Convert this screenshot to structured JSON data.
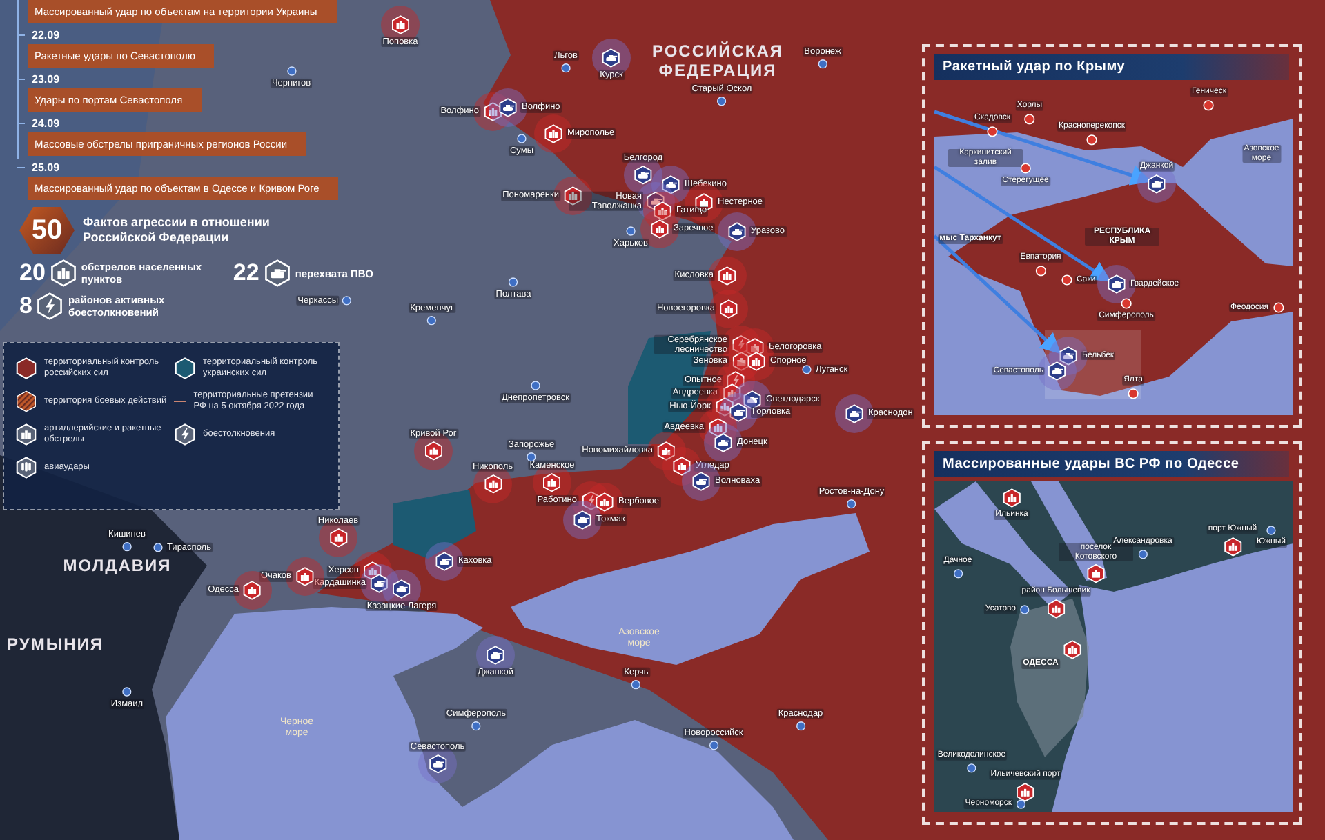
{
  "timeline": [
    {
      "text": "Массированный удар по объектам на территории Украины"
    },
    {
      "date": "22.09",
      "text": "Ракетные удары по Севастополю"
    },
    {
      "date": "23.09",
      "text": "Удары по портам Севастополя"
    },
    {
      "date": "24.09",
      "text": "Массовые обстрелы приграничных регионов России"
    },
    {
      "date": "25.09",
      "text": "Массированный удар по объектам в Одессе и Кривом Роге"
    }
  ],
  "summary": {
    "count": "50",
    "text": "Фактов агрессии в отношении Российской Федерации"
  },
  "stats": [
    {
      "count": "20",
      "text": "обстрелов населенных пунктов",
      "kind": "shelling"
    },
    {
      "count": "22",
      "text": "перехвата ПВО",
      "kind": "intercept"
    },
    {
      "count": "8",
      "text": "районов активных боестолкновений",
      "kind": "clash"
    }
  ],
  "legend": [
    {
      "kind": "ru-control",
      "text": "территориальный контроль российских сил"
    },
    {
      "kind": "ua-control",
      "text": "территориальный контроль украинских сил"
    },
    {
      "kind": "combat-zone",
      "text": "территория боевых действий"
    },
    {
      "kind": "claims-line",
      "text": "территориальные претензии РФ на 5 октября 2022 года"
    },
    {
      "kind": "shelling",
      "text": "артиллерийские и ракетные обстрелы"
    },
    {
      "kind": "clash",
      "text": "боестолкновения"
    },
    {
      "kind": "airstrike",
      "text": "авиаудары"
    }
  ],
  "map": {
    "regions": [
      {
        "text": "РОССИЙСКАЯ ФЕДЕРАЦИЯ",
        "kind": "country"
      },
      {
        "text": "МОЛДАВИЯ",
        "kind": "country"
      },
      {
        "text": "РУМЫНИЯ",
        "kind": "country"
      },
      {
        "text": "Азовское море",
        "kind": "sea"
      },
      {
        "text": "Черное море",
        "kind": "sea"
      }
    ],
    "markers": [
      {
        "label": "Поповка",
        "kind": "shelling"
      },
      {
        "label": "Волфино",
        "kind": "shelling"
      },
      {
        "label": "Волфино",
        "kind": "intercept"
      },
      {
        "label": "Мирополье",
        "kind": "shelling"
      },
      {
        "label": "Пономаренки",
        "kind": "shelling"
      },
      {
        "label": "Курск",
        "kind": "intercept"
      },
      {
        "label": "Белгород",
        "kind": "intercept"
      },
      {
        "label": "Шебекино",
        "kind": "intercept"
      },
      {
        "label": "Новая Таволжанка",
        "kind": "intercept"
      },
      {
        "label": "Нестерное",
        "kind": "shelling"
      },
      {
        "label": "Гатище",
        "kind": "shelling"
      },
      {
        "label": "Заречное",
        "kind": "shelling"
      },
      {
        "label": "Уразово",
        "kind": "intercept"
      },
      {
        "label": "Кисловка",
        "kind": "shelling"
      },
      {
        "label": "Новоегоровка",
        "kind": "shelling"
      },
      {
        "label": "Серебрянское лесничество",
        "kind": "clash"
      },
      {
        "label": "Белогоровка",
        "kind": "shelling"
      },
      {
        "label": "Зеновка",
        "kind": "shelling"
      },
      {
        "label": "Спорное",
        "kind": "shelling"
      },
      {
        "label": "Опытное",
        "kind": "clash"
      },
      {
        "label": "Андреевка",
        "kind": "shelling"
      },
      {
        "label": "Светлодарск",
        "kind": "intercept"
      },
      {
        "label": "Нью-Йорк",
        "kind": "shelling"
      },
      {
        "label": "Горловка",
        "kind": "intercept"
      },
      {
        "label": "Авдеевка",
        "kind": "shelling"
      },
      {
        "label": "Донецк",
        "kind": "intercept"
      },
      {
        "label": "Краснодон",
        "kind": "intercept"
      },
      {
        "label": "Луганск",
        "kind": "city"
      },
      {
        "label": "Кривой Рог",
        "kind": "shelling"
      },
      {
        "label": "Новомихайловка",
        "kind": "shelling"
      },
      {
        "label": "Угледар",
        "kind": "shelling"
      },
      {
        "label": "Волноваха",
        "kind": "intercept"
      },
      {
        "label": "Никополь",
        "kind": "shelling"
      },
      {
        "label": "Каменское",
        "kind": "shelling"
      },
      {
        "label": "Работино",
        "kind": "clash"
      },
      {
        "label": "Вербовое",
        "kind": "shelling"
      },
      {
        "label": "Токмак",
        "kind": "intercept"
      },
      {
        "label": "Николаев",
        "kind": "shelling"
      },
      {
        "label": "Херсон",
        "kind": "shelling"
      },
      {
        "label": "Каховка",
        "kind": "intercept"
      },
      {
        "label": "Кардашинка",
        "kind": "intercept"
      },
      {
        "label": "Казацкие Лагеря",
        "kind": "intercept"
      },
      {
        "label": "Очаков",
        "kind": "shelling"
      },
      {
        "label": "Одесса",
        "kind": "shelling"
      },
      {
        "label": "Джанкой",
        "kind": "intercept"
      },
      {
        "label": "Севастополь",
        "kind": "intercept"
      },
      {
        "label": "Льгов",
        "kind": "city"
      },
      {
        "label": "Воронеж",
        "kind": "city"
      },
      {
        "label": "Старый Оскол",
        "kind": "city"
      },
      {
        "label": "Сумы",
        "kind": "city"
      },
      {
        "label": "Харьков",
        "kind": "city"
      },
      {
        "label": "Полтава",
        "kind": "city"
      },
      {
        "label": "Кременчуг",
        "kind": "city"
      },
      {
        "label": "Днепропетровск",
        "kind": "city"
      },
      {
        "label": "Запорожье",
        "kind": "city"
      },
      {
        "label": "Черкассы",
        "kind": "city"
      },
      {
        "label": "Чернигов",
        "kind": "city"
      },
      {
        "label": "Ростов-на-Дону",
        "kind": "city"
      },
      {
        "label": "Керчь",
        "kind": "city"
      },
      {
        "label": "Симферополь",
        "kind": "city"
      },
      {
        "label": "Новороссийск",
        "kind": "city"
      },
      {
        "label": "Краснодар",
        "kind": "city"
      },
      {
        "label": "Кишинев",
        "kind": "city"
      },
      {
        "label": "Тирасполь",
        "kind": "city"
      },
      {
        "label": "Измаил",
        "kind": "city"
      }
    ]
  },
  "crimea_inset": {
    "title": "Ракетный удар по Крыму",
    "labels": [
      {
        "label": "Скадовск",
        "kind": "strike"
      },
      {
        "label": "Хорлы",
        "kind": "strike"
      },
      {
        "label": "Красноперекопск",
        "kind": "strike"
      },
      {
        "label": "Геническ",
        "kind": "strike"
      },
      {
        "label": "Каркинитский залив",
        "kind": "sea"
      },
      {
        "label": "Стерегущее",
        "kind": "strike"
      },
      {
        "label": "Азовское море",
        "kind": "sea"
      },
      {
        "label": "Джанкой",
        "kind": "intercept"
      },
      {
        "label": "мыс Тарханкут",
        "kind": "region"
      },
      {
        "label": "РЕСПУБЛИКА КРЫМ",
        "kind": "region"
      },
      {
        "label": "Евпатория",
        "kind": "strike"
      },
      {
        "label": "Саки",
        "kind": "strike"
      },
      {
        "label": "Гвардейское",
        "kind": "intercept"
      },
      {
        "label": "Симферополь",
        "kind": "strike"
      },
      {
        "label": "Феодосия",
        "kind": "strike"
      },
      {
        "label": "Бельбек",
        "kind": "intercept"
      },
      {
        "label": "Севастополь",
        "kind": "intercept"
      },
      {
        "label": "Ялта",
        "kind": "strike"
      }
    ]
  },
  "odessa_inset": {
    "title": "Массированные удары ВС РФ по Одессе",
    "labels": [
      {
        "label": "Ильинка",
        "kind": "strike"
      },
      {
        "label": "Александровка",
        "kind": "city"
      },
      {
        "label": "порт Южный",
        "kind": "strike"
      },
      {
        "label": "Южный",
        "kind": "city"
      },
      {
        "label": "поселок Котовского",
        "kind": "strike"
      },
      {
        "label": "Дачное",
        "kind": "city"
      },
      {
        "label": "район Большевик",
        "kind": "strike"
      },
      {
        "label": "Усатово",
        "kind": "city"
      },
      {
        "kind": "strike"
      },
      {
        "label": "ОДЕССА",
        "kind": "region"
      },
      {
        "label": "Великодолинское",
        "kind": "city"
      },
      {
        "label": "Ильичевский порт",
        "kind": "strike"
      },
      {
        "label": "Черноморск",
        "kind": "city"
      }
    ]
  }
}
